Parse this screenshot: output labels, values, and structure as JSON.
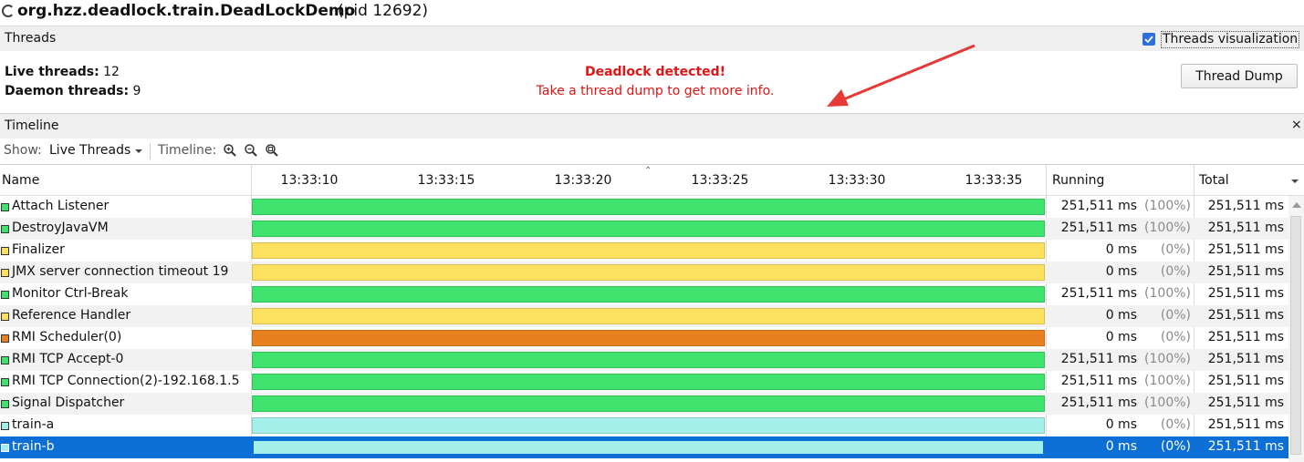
{
  "title": {
    "app": "org.hzz.deadlock.train.DeadLockDemo",
    "pid": "(pid 12692)"
  },
  "threads_panel": {
    "label": "Threads",
    "viz_label": "Threads visualization",
    "viz_checked": true,
    "live_label": "Live threads:",
    "live_value": "12",
    "daemon_label": "Daemon threads:",
    "daemon_value": "9",
    "deadlock_title": "Deadlock detected!",
    "deadlock_msg": "Take a thread dump to get more info.",
    "dump_button": "Thread Dump"
  },
  "timeline_panel": {
    "label": "Timeline",
    "close": "×",
    "show_label": "Show:",
    "show_value": "Live Threads",
    "timeline_label": "Timeline:",
    "zoom_icons": [
      "zoom-in-icon",
      "zoom-out-icon",
      "zoom-fit-icon"
    ]
  },
  "table": {
    "columns": {
      "name": "Name",
      "running": "Running",
      "total": "Total"
    },
    "ticks": [
      "13:33:10",
      "13:33:15",
      "13:33:20",
      "13:33:25",
      "13:33:30",
      "13:33:35"
    ],
    "colors": {
      "running": "#3ee26c",
      "sleeping": "#fde05e",
      "wait": "#e8801f",
      "park": "#a3efea"
    },
    "rows": [
      {
        "name": "Attach Listener",
        "state": "running",
        "running": "251,511 ms",
        "pct": "(100%)",
        "total": "251,511 ms"
      },
      {
        "name": "DestroyJavaVM",
        "state": "running",
        "running": "251,511 ms",
        "pct": "(100%)",
        "total": "251,511 ms"
      },
      {
        "name": "Finalizer",
        "state": "sleeping",
        "running": "0 ms",
        "pct": "(0%)",
        "total": "251,511 ms"
      },
      {
        "name": "JMX server connection timeout 19",
        "state": "sleeping",
        "running": "0 ms",
        "pct": "(0%)",
        "total": "251,511 ms"
      },
      {
        "name": "Monitor Ctrl-Break",
        "state": "running",
        "running": "251,511 ms",
        "pct": "(100%)",
        "total": "251,511 ms"
      },
      {
        "name": "Reference Handler",
        "state": "sleeping",
        "running": "0 ms",
        "pct": "(0%)",
        "total": "251,511 ms"
      },
      {
        "name": "RMI Scheduler(0)",
        "state": "wait",
        "running": "0 ms",
        "pct": "(0%)",
        "total": "251,511 ms"
      },
      {
        "name": "RMI TCP Accept-0",
        "state": "running",
        "running": "251,511 ms",
        "pct": "(100%)",
        "total": "251,511 ms"
      },
      {
        "name": "RMI TCP Connection(2)-192.168.1.5",
        "state": "running",
        "running": "251,511 ms",
        "pct": "(100%)",
        "total": "251,511 ms"
      },
      {
        "name": "Signal Dispatcher",
        "state": "running",
        "running": "251,511 ms",
        "pct": "(100%)",
        "total": "251,511 ms"
      },
      {
        "name": "train-a",
        "state": "park",
        "running": "0 ms",
        "pct": "(0%)",
        "total": "251,511 ms"
      },
      {
        "name": "train-b",
        "state": "park",
        "running": "0 ms",
        "pct": "(0%)",
        "total": "251,511 ms",
        "selected": true
      }
    ]
  },
  "annotation": {
    "arrow_color": "#e53935"
  }
}
